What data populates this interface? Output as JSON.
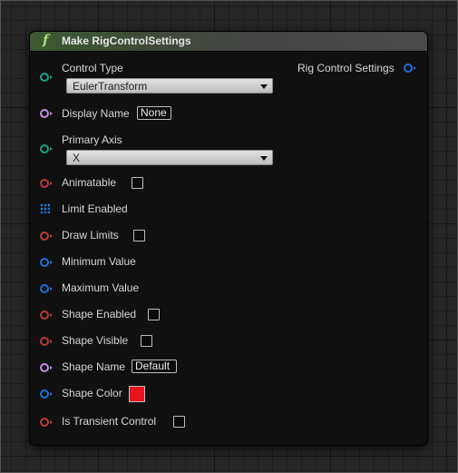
{
  "node": {
    "title": "Make RigControlSettings",
    "function_icon": "f",
    "output": {
      "label": "Rig Control Settings"
    }
  },
  "pins": {
    "control_type": {
      "label": "Control Type",
      "value": "EulerTransform"
    },
    "display_name": {
      "label": "Display Name",
      "value": "None"
    },
    "primary_axis": {
      "label": "Primary Axis",
      "value": "X"
    },
    "animatable": {
      "label": "Animatable"
    },
    "limit_enabled": {
      "label": "Limit Enabled"
    },
    "draw_limits": {
      "label": "Draw Limits"
    },
    "minimum_value": {
      "label": "Minimum Value"
    },
    "maximum_value": {
      "label": "Maximum Value"
    },
    "shape_enabled": {
      "label": "Shape Enabled"
    },
    "shape_visible": {
      "label": "Shape Visible"
    },
    "shape_name": {
      "label": "Shape Name",
      "value": "Default"
    },
    "shape_color": {
      "label": "Shape Color",
      "color": "#e8141c"
    },
    "is_transient_control": {
      "label": "Is Transient Control"
    }
  },
  "colors": {
    "enum_pin": "#1aa383",
    "name_pin": "#c58ee6",
    "bool_pin": "#b83a3a",
    "struct_pin": "#1f6fd6",
    "array_pin": "#1e6fd8"
  }
}
